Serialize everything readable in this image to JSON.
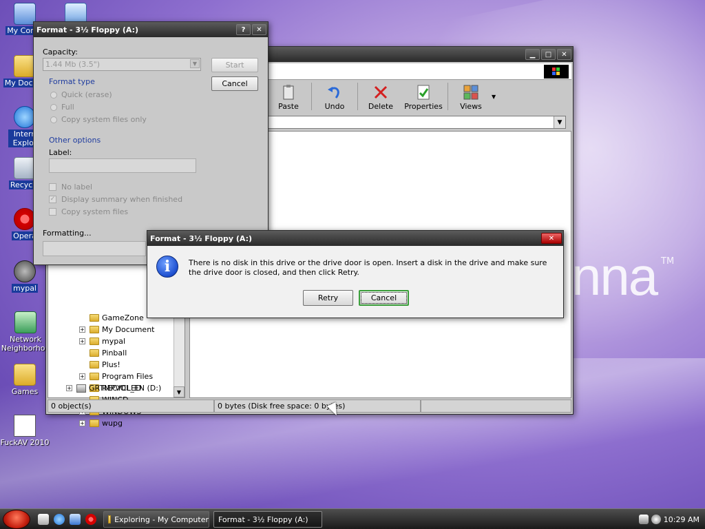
{
  "desktop": {
    "brand": "nna",
    "brand_tm": "TM",
    "icons": [
      {
        "label": "My Comp"
      },
      {
        "label": "My Docum"
      },
      {
        "label": "Intern Explor"
      },
      {
        "label": "Recycle"
      },
      {
        "label": "Opera"
      },
      {
        "label": "mypal"
      },
      {
        "label": "Network Neighborhoo"
      },
      {
        "label": "Games"
      },
      {
        "label": "FuckAV 2010"
      }
    ]
  },
  "explorer": {
    "toolbar": {
      "paste": "Paste",
      "undo": "Undo",
      "delete": "Delete",
      "properties": "Properties",
      "views": "Views"
    },
    "tree": [
      {
        "label": "GameZone",
        "expander": false
      },
      {
        "label": "My Document",
        "expander": true
      },
      {
        "label": "mypal",
        "expander": true
      },
      {
        "label": "Pinball",
        "expander": false
      },
      {
        "label": "Plus!",
        "expander": false
      },
      {
        "label": "Program Files",
        "expander": true
      },
      {
        "label": "RECYCLED",
        "expander": false
      },
      {
        "label": "WINCD",
        "expander": false
      },
      {
        "label": "WINDOWS",
        "expander": true
      },
      {
        "label": "wupg",
        "expander": true
      }
    ],
    "drive": "GRTMPVOL_EN (D:)",
    "status": {
      "objects": "0 object(s)",
      "size": "0 bytes (Disk free space: 0 bytes)"
    }
  },
  "format_window": {
    "title": "Format - 3½ Floppy (A:)",
    "help_btn": "?",
    "close_btn": "✕",
    "capacity_label": "Capacity:",
    "capacity_value": "1.44 Mb (3.5\")",
    "start_label": "Start",
    "cancel_label": "Cancel",
    "format_type_title": "Format type",
    "format_types": [
      "Quick (erase)",
      "Full",
      "Copy system files only"
    ],
    "other_options_title": "Other options",
    "label_label": "Label:",
    "options": [
      {
        "label": "No label",
        "checked": false
      },
      {
        "label": "Display summary when finished",
        "checked": true
      },
      {
        "label": "Copy system files",
        "checked": false
      }
    ],
    "formatting_label": "Formatting..."
  },
  "error_dialog": {
    "title": "Format - 3½ Floppy (A:)",
    "close_btn": "✕",
    "icon_glyph": "i",
    "message": "There is no disk in this drive or the drive door is open. Insert a disk in the drive and make sure the drive door is closed, and then click Retry.",
    "retry_label": "Retry",
    "cancel_label": "Cancel"
  },
  "taskbar": {
    "tasks": [
      "Exploring - My Computer",
      "Format - 3½ Floppy (A:)"
    ],
    "clock": "10:29 AM"
  }
}
